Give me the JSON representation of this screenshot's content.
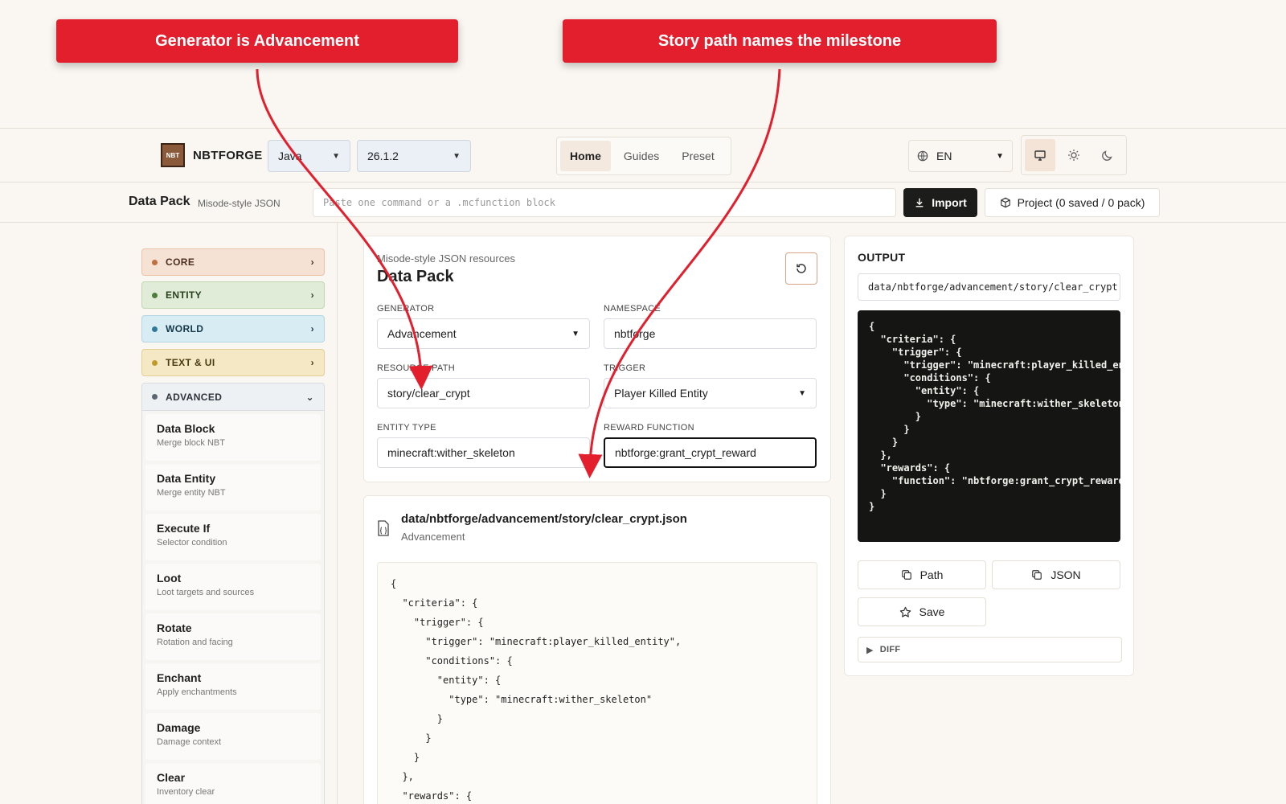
{
  "callouts": {
    "left": "Generator is Advancement",
    "right": "Story path names the milestone"
  },
  "nav": {
    "brand": "NBTFORGE",
    "logo_text": "NBT",
    "edition": "Java",
    "version": "26.1.2",
    "tabs": [
      "Home",
      "Guides",
      "Preset"
    ],
    "active_tab": "Home",
    "language": "EN"
  },
  "toolbar": {
    "title": "Data Pack",
    "subtitle": "Misode-style JSON",
    "command_placeholder": "Paste one command or a .mcfunction block",
    "import_label": "Import",
    "project_label": "Project (0 saved / 0 pack)"
  },
  "sidebar": {
    "categories": [
      "CORE",
      "ENTITY",
      "WORLD",
      "TEXT & UI",
      "ADVANCED"
    ],
    "advanced_items": [
      {
        "title": "Data Block",
        "desc": "Merge block NBT"
      },
      {
        "title": "Data Entity",
        "desc": "Merge entity NBT"
      },
      {
        "title": "Execute If",
        "desc": "Selector condition"
      },
      {
        "title": "Loot",
        "desc": "Loot targets and sources"
      },
      {
        "title": "Rotate",
        "desc": "Rotation and facing"
      },
      {
        "title": "Enchant",
        "desc": "Apply enchantments"
      },
      {
        "title": "Damage",
        "desc": "Damage context"
      },
      {
        "title": "Clear",
        "desc": "Inventory clear"
      }
    ]
  },
  "form": {
    "subtitle": "Misode-style JSON resources",
    "title": "Data Pack",
    "generator": {
      "label": "GENERATOR",
      "value": "Advancement"
    },
    "namespace": {
      "label": "NAMESPACE",
      "value": "nbtforge"
    },
    "resource_path": {
      "label": "RESOURCE PATH",
      "value": "story/clear_crypt"
    },
    "trigger": {
      "label": "TRIGGER",
      "value": "Player Killed Entity"
    },
    "entity_type": {
      "label": "ENTITY TYPE",
      "value": "minecraft:wither_skeleton"
    },
    "reward_function": {
      "label": "REWARD FUNCTION",
      "value": "nbtforge:grant_crypt_reward"
    }
  },
  "preview": {
    "path": "data/nbtforge/advancement/story/clear_crypt.json",
    "kind": "Advancement",
    "code": "{\n  \"criteria\": {\n    \"trigger\": {\n      \"trigger\": \"minecraft:player_killed_entity\",\n      \"conditions\": {\n        \"entity\": {\n          \"type\": \"minecraft:wither_skeleton\"\n        }\n      }\n    }\n  },\n  \"rewards\": {"
  },
  "output": {
    "label": "OUTPUT",
    "path": "data/nbtforge/advancement/story/clear_crypt.json",
    "code": "{\n  \"criteria\": {\n    \"trigger\": {\n      \"trigger\": \"minecraft:player_killed_entity\",\n      \"conditions\": {\n        \"entity\": {\n          \"type\": \"minecraft:wither_skeleton\"\n        }\n      }\n    }\n  },\n  \"rewards\": {\n    \"function\": \"nbtforge:grant_crypt_reward\"\n  }\n}",
    "path_button": "Path",
    "json_button": "JSON",
    "save_button": "Save",
    "diff_label": "DIFF"
  },
  "colors": {
    "callout": "#e31e2d",
    "accent_dark": "#1c1c1a",
    "background": "#faf7f2"
  }
}
